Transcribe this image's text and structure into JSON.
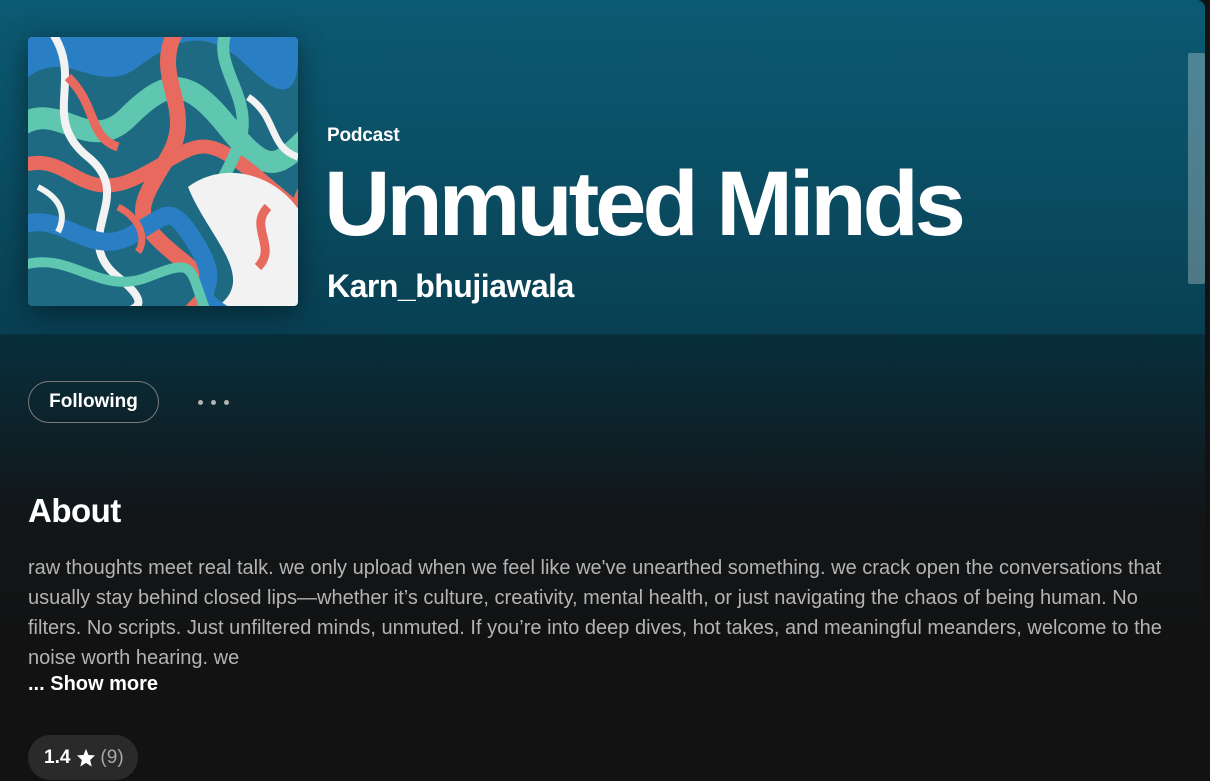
{
  "header": {
    "type_label": "Podcast",
    "title": "Unmuted Minds",
    "author": "Karn_bhujiawala"
  },
  "cover": {
    "icon": "podcast-cover-art",
    "colors": [
      "#1e6f86",
      "#e86a5e",
      "#5fc7b0",
      "#f2f2f2",
      "#2a7fc4"
    ]
  },
  "actions": {
    "follow_label": "Following",
    "more_icon": "more-options-icon"
  },
  "about": {
    "heading": "About",
    "description": "raw thoughts meet real talk. we only upload when we feel like we've unearthed something. we crack open the conversations that usually stay behind closed lips—whether it’s culture, creativity, mental health, or just navigating the chaos of being human. No filters. No scripts. Just unfiltered minds, unmuted. If you’re into deep dives, hot takes, and meaningful meanders, welcome to the noise worth hearing. we",
    "show_more": "... Show more"
  },
  "rating": {
    "score": "1.4",
    "count": "(9)",
    "icon": "star-icon"
  },
  "colors": {
    "hero": "#0b5a73",
    "background": "#121212",
    "secondary_text": "#b3b3b3"
  }
}
